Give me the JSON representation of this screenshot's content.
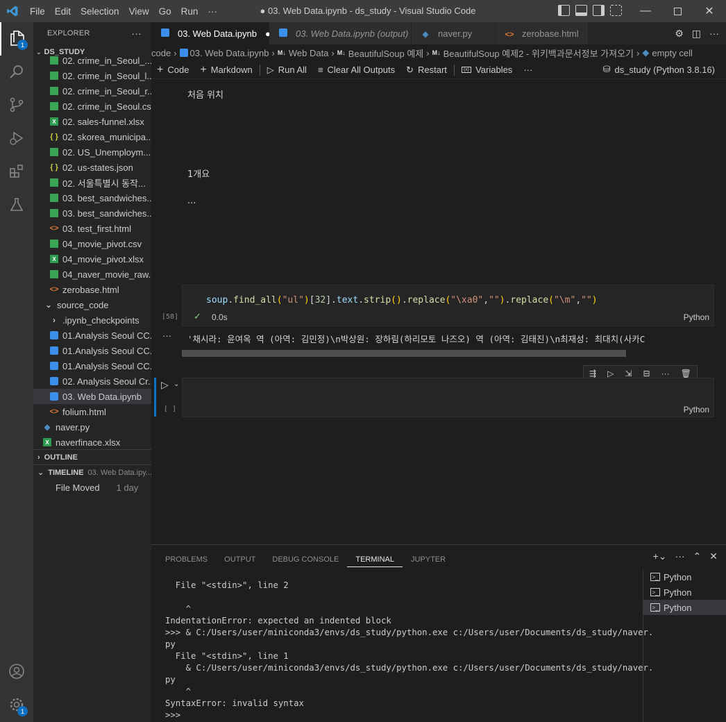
{
  "titlebar": {
    "menu": [
      "File",
      "Edit",
      "Selection",
      "View",
      "Go",
      "Run",
      "···"
    ],
    "title": "● 03. Web Data.ipynb - ds_study - Visual Studio Code"
  },
  "activity": {
    "explorer_badge": "1",
    "accounts_badge": "1"
  },
  "sidebar": {
    "header": "EXPLORER",
    "workspace": "DS_STUDY",
    "files": [
      {
        "name": "02. crime_in_Seoul_...",
        "type": "csv",
        "indent": 24
      },
      {
        "name": "02. crime_in_Seoul_l...",
        "type": "csv",
        "indent": 24
      },
      {
        "name": "02. crime_in_Seoul_r...",
        "type": "csv",
        "indent": 24
      },
      {
        "name": "02. crime_in_Seoul.csv",
        "type": "csv",
        "indent": 24
      },
      {
        "name": "02. sales-funnel.xlsx",
        "type": "xlsx",
        "indent": 24
      },
      {
        "name": "02. skorea_municipa...",
        "type": "json",
        "indent": 24
      },
      {
        "name": "02. US_Unemploym...",
        "type": "csv",
        "indent": 24
      },
      {
        "name": "02. us-states.json",
        "type": "json",
        "indent": 24
      },
      {
        "name": "02. 서울특별시 동작...",
        "type": "csv",
        "indent": 24
      },
      {
        "name": "03. best_sandwiches...",
        "type": "csv",
        "indent": 24
      },
      {
        "name": "03. best_sandwiches...",
        "type": "csv",
        "indent": 24
      },
      {
        "name": "03. test_first.html",
        "type": "html",
        "indent": 24
      },
      {
        "name": "04_movie_pivot.csv",
        "type": "csv",
        "indent": 24
      },
      {
        "name": "04_movie_pivot.xlsx",
        "type": "xlsx",
        "indent": 24
      },
      {
        "name": "04_naver_movie_raw...",
        "type": "csv",
        "indent": 24
      },
      {
        "name": "zerobase.html",
        "type": "html",
        "indent": 24
      },
      {
        "name": "source_code",
        "type": "folder-open",
        "indent": 16
      },
      {
        "name": ".ipynb_checkpoints",
        "type": "folder",
        "indent": 24
      },
      {
        "name": "01.Analysis Seoul CC...",
        "type": "nb",
        "indent": 24
      },
      {
        "name": "01.Analysis Seoul CC...",
        "type": "nb",
        "indent": 24
      },
      {
        "name": "01.Analysis Seoul CC...",
        "type": "nb",
        "indent": 24
      },
      {
        "name": "02. Analysis Seoul Cr...",
        "type": "nb",
        "indent": 24
      },
      {
        "name": "03. Web Data.ipynb",
        "type": "nb",
        "indent": 24,
        "selected": true
      },
      {
        "name": "folium.html",
        "type": "html",
        "indent": 24
      },
      {
        "name": "naver.py",
        "type": "py",
        "indent": 14
      },
      {
        "name": "naverfinace.xlsx",
        "type": "xlsx",
        "indent": 14
      }
    ],
    "outline": "OUTLINE",
    "timeline": "TIMELINE",
    "timeline_file": "03. Web Data.ipy...",
    "timeline_entry": "File Moved",
    "timeline_time": "1 day"
  },
  "tabs": [
    {
      "label": "03. Web Data.ipynb",
      "active": true,
      "dirty": true
    },
    {
      "label": "03. Web Data.ipynb (output)",
      "italic": true
    },
    {
      "label": "naver.py"
    },
    {
      "label": "zerobase.html"
    }
  ],
  "breadcrumb": [
    "code",
    "03. Web Data.ipynb",
    "Web Data",
    "BeautifulSoup 예제",
    "BeautifulSoup 예제2 - 위키백과문서정보 가져오기",
    "empty cell"
  ],
  "toolbar": {
    "code": "Code",
    "markdown": "Markdown",
    "run_all": "Run All",
    "clear": "Clear All Outputs",
    "restart": "Restart",
    "variables": "Variables",
    "more": "···",
    "kernel": "ds_study (Python 3.8.16)"
  },
  "notebook": {
    "md1": "처음 위치",
    "md2": "1개요",
    "md3": "...",
    "cell1": {
      "exec": "[58]",
      "time": "0.0s",
      "lang": "Python",
      "code": "soup.find_all(\"ul\")[32].text.strip().replace(\"\\xa0\",\"\").replace(\"\\m\",\"\")",
      "output": "'채시라: 윤여옥 역 (아역: 김민정)\\n박상원: 장하림(하리모토 나즈오) 역 (아역: 김태진)\\n최재성: 최대치(사카C"
    },
    "cell2": {
      "exec": "[ ]",
      "lang": "Python"
    }
  },
  "panel": {
    "tabs": [
      "PROBLEMS",
      "OUTPUT",
      "DEBUG CONSOLE",
      "TERMINAL",
      "JUPYTER"
    ],
    "active_tab": "TERMINAL",
    "terminal_lines": [
      "  File \"<stdin>\", line 2",
      "",
      "    ^",
      "IndentationError: expected an indented block",
      ">>> & C:/Users/user/miniconda3/envs/ds_study/python.exe c:/Users/user/Documents/ds_study/naver.",
      "py",
      "  File \"<stdin>\", line 1",
      "    & C:/Users/user/miniconda3/envs/ds_study/python.exe c:/Users/user/Documents/ds_study/naver.",
      "py",
      "    ^",
      "SyntaxError: invalid syntax",
      ">>>"
    ],
    "terminals": [
      "Python",
      "Python",
      "Python"
    ]
  },
  "colors": {
    "accent": "#0e70c0",
    "titlebar": "#3c3c3c",
    "activitybar": "#333333",
    "sidebar": "#252526",
    "editor": "#1e1e1e"
  }
}
